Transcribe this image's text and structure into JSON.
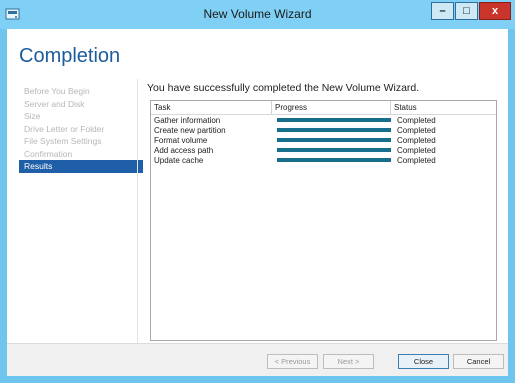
{
  "window": {
    "title": "New Volume Wizard",
    "controls": {
      "minimize": "–",
      "maximize": "□",
      "close": "x"
    }
  },
  "page": {
    "heading": "Completion",
    "message": "You have successfully completed the New Volume Wizard."
  },
  "nav": {
    "items": [
      {
        "label": "Before You Begin"
      },
      {
        "label": "Server and Disk"
      },
      {
        "label": "Size"
      },
      {
        "label": "Drive Letter or Folder"
      },
      {
        "label": "File System Settings"
      },
      {
        "label": "Confirmation"
      },
      {
        "label": "Results"
      }
    ]
  },
  "table": {
    "headers": {
      "task": "Task",
      "progress": "Progress",
      "status": "Status"
    },
    "rows": [
      {
        "task": "Gather information",
        "progress": 1.0,
        "status": "Completed"
      },
      {
        "task": "Create new partition",
        "progress": 1.0,
        "status": "Completed"
      },
      {
        "task": "Format volume",
        "progress": 1.0,
        "status": "Completed"
      },
      {
        "task": "Add access path",
        "progress": 1.0,
        "status": "Completed"
      },
      {
        "task": "Update cache",
        "progress": 1.0,
        "status": "Completed"
      }
    ]
  },
  "footer": {
    "previous": "< Previous",
    "next": "Next >",
    "close": "Close",
    "cancel": "Cancel"
  },
  "colors": {
    "heading": "#1c5c9c",
    "active_nav": "#1f5fa8",
    "progress": "#16708c",
    "titlebar": "#7fd0f4",
    "close_button": "#c9352b"
  }
}
